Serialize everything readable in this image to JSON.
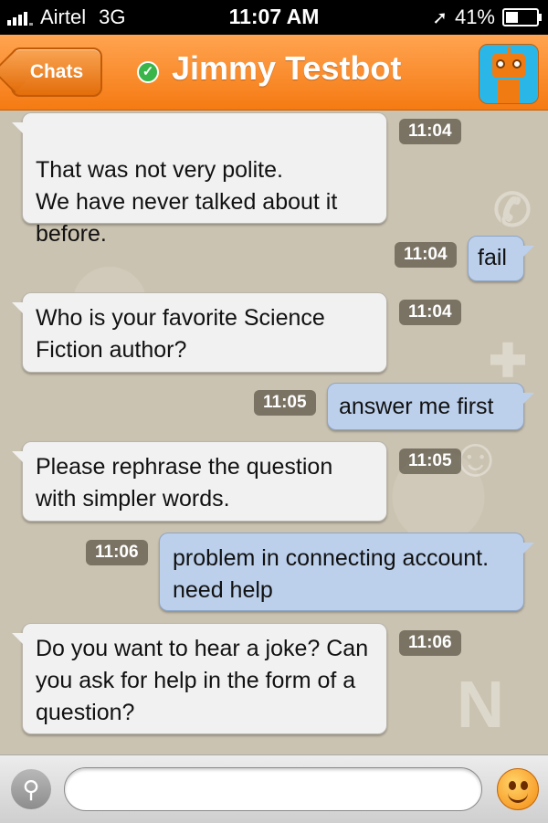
{
  "status_bar": {
    "carrier": "Airtel",
    "network": "3G",
    "time": "11:07 AM",
    "battery": "41%"
  },
  "header": {
    "back_label": "Chats",
    "contact_name": "Jimmy Testbot",
    "online_status_icon": "check-circle-icon",
    "avatar_icon": "robot-avatar-icon"
  },
  "messages": [
    {
      "direction": "incoming",
      "text": "That was not very polite.\nWe have never talked about it before.",
      "time": "11:04"
    },
    {
      "direction": "outgoing",
      "text": "fail",
      "time": "11:04"
    },
    {
      "direction": "incoming",
      "text": "Who is your favorite Science Fiction author?",
      "time": "11:04"
    },
    {
      "direction": "outgoing",
      "text": "answer me first",
      "time": "11:05"
    },
    {
      "direction": "incoming",
      "text": "Please rephrase the question with simpler words.",
      "time": "11:05"
    },
    {
      "direction": "outgoing",
      "text": "problem in connecting account. need help",
      "time": "11:06"
    },
    {
      "direction": "incoming",
      "text": "Do you want to hear a joke? Can you ask for help in the form of a question?",
      "time": "11:06"
    }
  ],
  "input_bar": {
    "attach_icon": "paperclip-icon",
    "message_value": "",
    "emoji_icon": "smiley-icon"
  },
  "colors": {
    "header_orange": "#f57a12",
    "incoming_bubble": "#f1f1f1",
    "outgoing_bubble": "#bcd0ec",
    "online_green": "#39b54a"
  }
}
